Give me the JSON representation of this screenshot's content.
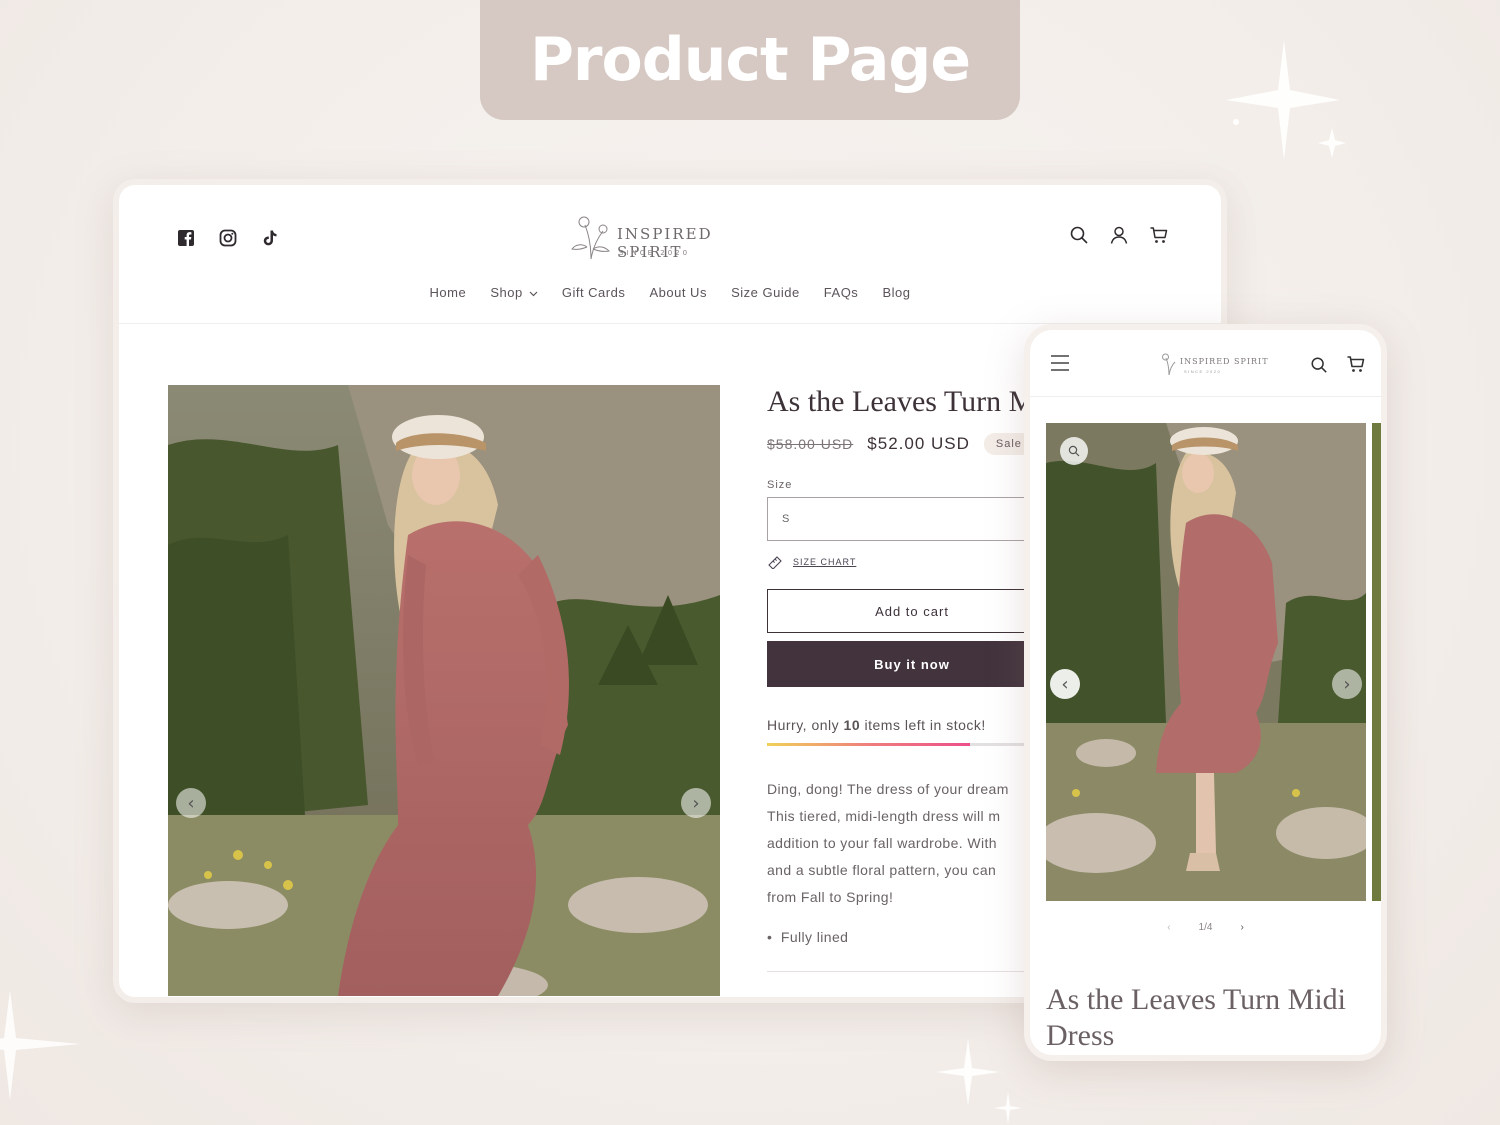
{
  "banner": {
    "title": "Product Page"
  },
  "brand": {
    "name": "INSPIRED SPIRIT",
    "tagline": "SINCE 2020"
  },
  "nav": {
    "items": [
      "Home",
      "Shop",
      "Gift Cards",
      "About Us",
      "Size Guide",
      "FAQs",
      "Blog"
    ]
  },
  "product": {
    "title": "As the Leaves Turn Midi Dress",
    "title_desktop_visible": "As the Leaves Turn M",
    "old_price": "$58.00 USD",
    "price": "$52.00 USD",
    "sale_badge": "Sale",
    "size_label": "Size",
    "size_value": "S",
    "size_chart_link": "SIZE CHART",
    "add_to_cart": "Add to cart",
    "buy_now": "Buy it now",
    "stock_prefix": "Hurry, only ",
    "stock_count": "10",
    "stock_suffix": " items left in stock!",
    "stock_fill_fraction": 0.7,
    "description_lines": [
      "Ding, dong! The dress of your dream",
      "This tiered, midi-length dress will m",
      "addition to your fall wardrobe. With",
      "and a subtle floral pattern, you can",
      "from Fall to Spring!"
    ],
    "features": [
      "Fully lined"
    ]
  },
  "mobile": {
    "pager": "1/4",
    "title": "As the Leaves Turn Midi Dress"
  },
  "icons": {
    "social": [
      "facebook-icon",
      "instagram-icon",
      "tiktok-icon"
    ],
    "header": [
      "search-icon",
      "account-icon",
      "cart-icon"
    ]
  },
  "colors": {
    "banner": "#d6c8c2",
    "buy_button": "#42333d",
    "accent_text": "#3c3238"
  }
}
